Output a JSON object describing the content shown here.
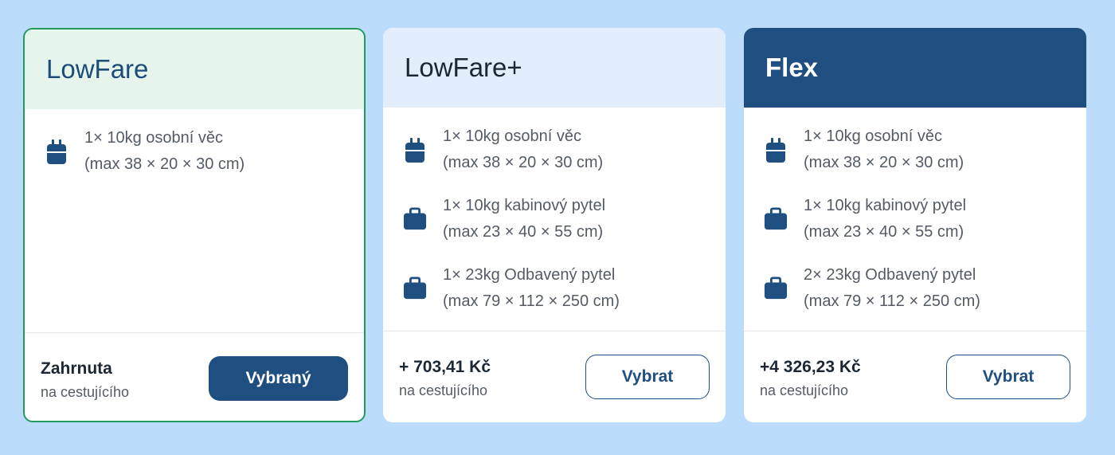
{
  "cards": [
    {
      "title": "LowFare",
      "items": [
        {
          "icon": "backpack-icon",
          "line1": "1× 10kg osobní věc",
          "line2": "(max 38 × 20 × 30 cm)"
        }
      ],
      "price": "Zahrnuta",
      "per": "na cestujícího",
      "button": "Vybraný"
    },
    {
      "title": "LowFare+",
      "items": [
        {
          "icon": "backpack-icon",
          "line1": "1× 10kg osobní věc",
          "line2": "(max 38 × 20 × 30 cm)"
        },
        {
          "icon": "suitcase-icon",
          "line1": "1× 10kg kabinový pytel",
          "line2": "(max 23 × 40 × 55 cm)"
        },
        {
          "icon": "suitcase-icon",
          "line1": "1× 23kg Odbavený pytel",
          "line2": "(max 79 × 112 × 250 cm)"
        }
      ],
      "price": "+ 703,41 Kč",
      "per": "na cestujícího",
      "button": "Vybrat"
    },
    {
      "title": "Flex",
      "items": [
        {
          "icon": "backpack-icon",
          "line1": "1× 10kg osobní věc",
          "line2": "(max 38 × 20 × 30 cm)"
        },
        {
          "icon": "suitcase-icon",
          "line1": "1× 10kg kabinový pytel",
          "line2": "(max 23 × 40 × 55 cm)"
        },
        {
          "icon": "suitcase-icon",
          "line1": "2× 23kg Odbavený pytel",
          "line2": "(max 79 × 112 × 250 cm)"
        }
      ],
      "price": "+4 326,23 Kč",
      "per": "na cestujícího",
      "button": "Vybrat"
    }
  ],
  "colors": {
    "background": "#bcdcfc",
    "accent": "#1f4e80",
    "selected_border": "#1f9a5c"
  }
}
